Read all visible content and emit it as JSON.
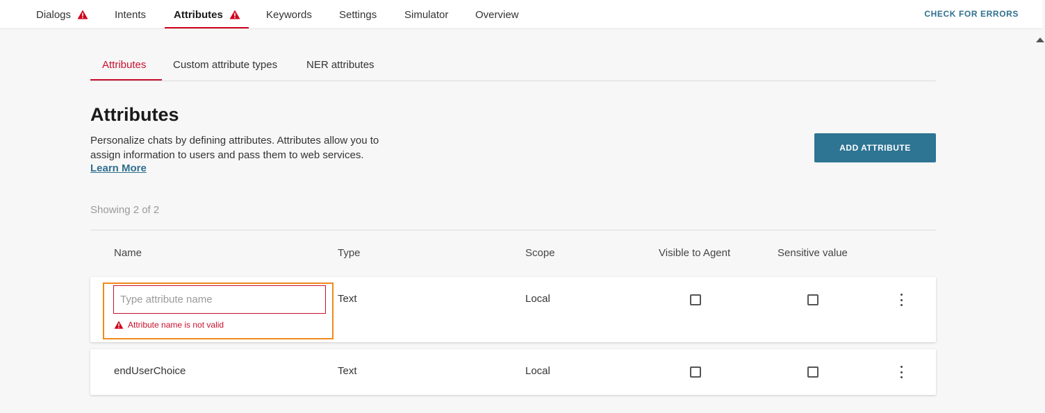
{
  "top_nav": {
    "tabs": [
      {
        "label": "Dialogs",
        "warning": true
      },
      {
        "label": "Intents",
        "warning": false
      },
      {
        "label": "Attributes",
        "warning": true,
        "active": true
      },
      {
        "label": "Keywords",
        "warning": false
      },
      {
        "label": "Settings",
        "warning": false
      },
      {
        "label": "Simulator",
        "warning": false
      },
      {
        "label": "Overview",
        "warning": false
      }
    ],
    "check_errors_label": "CHECK FOR ERRORS"
  },
  "sub_tabs": [
    {
      "label": "Attributes",
      "active": true
    },
    {
      "label": "Custom attribute types",
      "active": false
    },
    {
      "label": "NER attributes",
      "active": false
    }
  ],
  "page": {
    "title": "Attributes",
    "description": "Personalize chats by defining attributes. Attributes allow you to assign information to users and pass them to web services.",
    "learn_more": "Learn More",
    "add_button": "ADD ATTRIBUTE",
    "showing": "Showing 2 of 2"
  },
  "table": {
    "headers": {
      "name": "Name",
      "type": "Type",
      "scope": "Scope",
      "visible": "Visible to Agent",
      "sensitive": "Sensitive value"
    },
    "rows": [
      {
        "name_value": "",
        "name_placeholder": "Type attribute name",
        "error": "Attribute name is not valid",
        "type": "Text",
        "scope": "Local",
        "visible_to_agent": false,
        "sensitive": false
      },
      {
        "name": "endUserChoice",
        "type": "Text",
        "scope": "Local",
        "visible_to_agent": false,
        "sensitive": false
      }
    ]
  },
  "colors": {
    "accent_red": "#c8102e",
    "primary_button": "#2e7493",
    "link": "#2f6f8f",
    "highlight_outline": "#ef8a1a"
  },
  "icons": [
    "warning-icon",
    "kebab-menu-icon",
    "scroll-up-arrow-icon"
  ]
}
